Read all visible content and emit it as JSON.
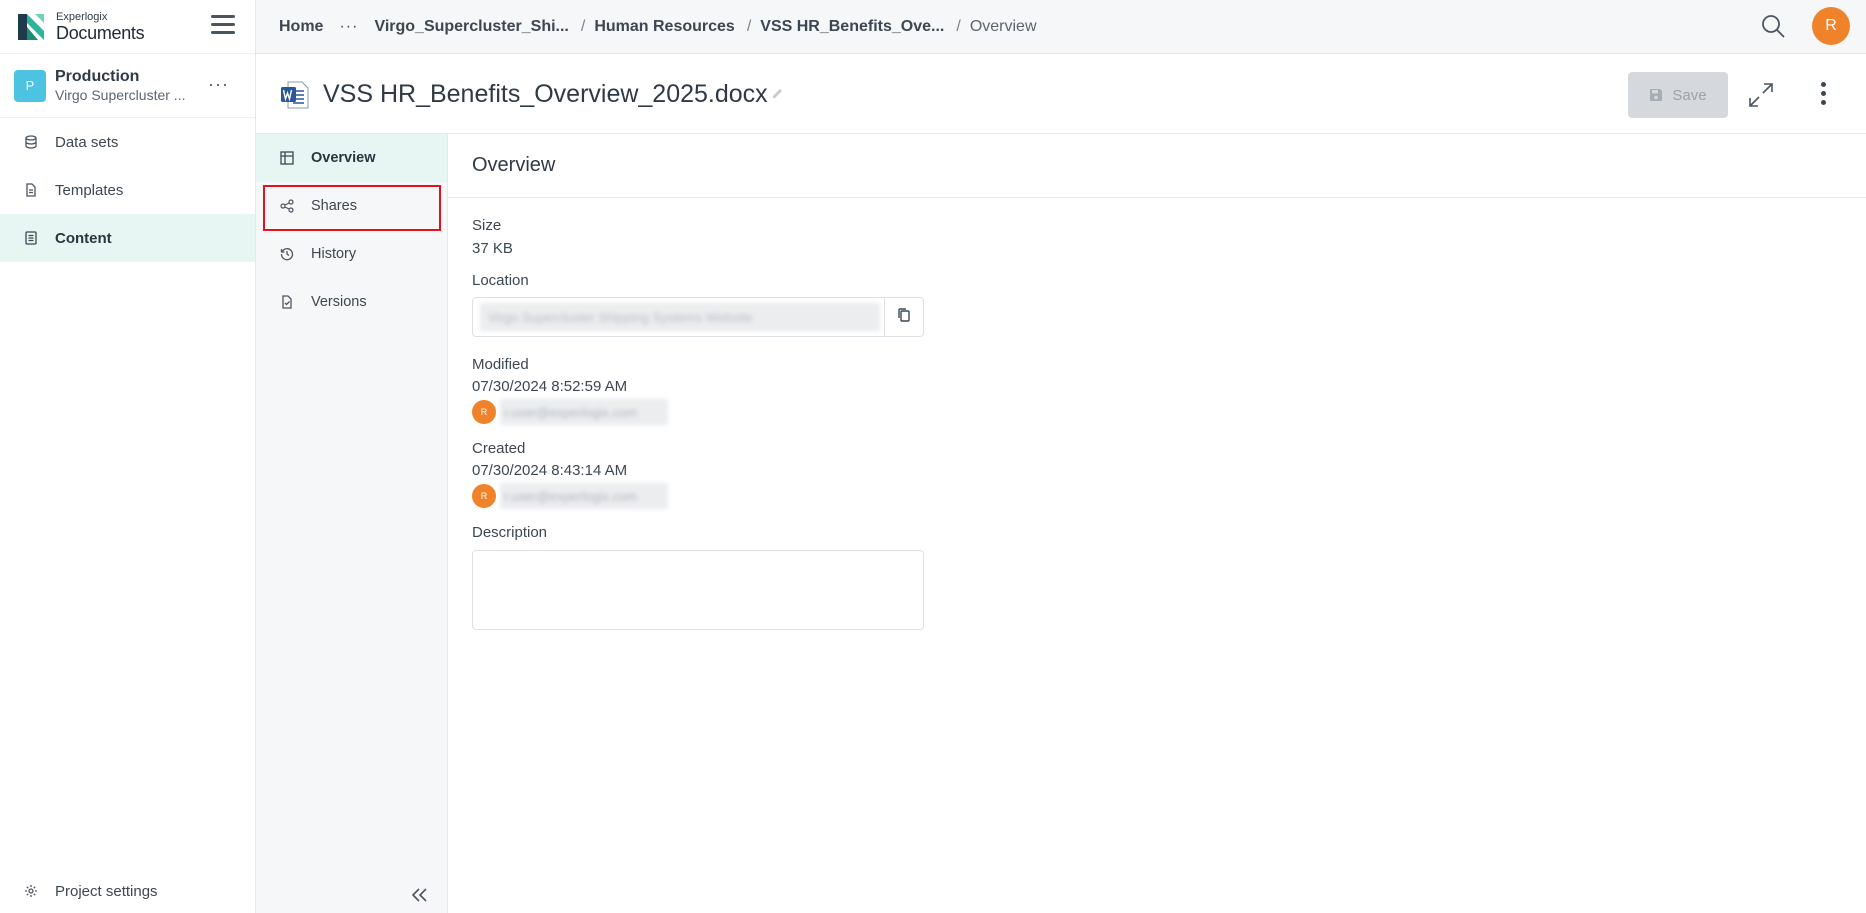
{
  "brand": {
    "small": "Experlogix",
    "big": "Documents"
  },
  "project": {
    "initial": "P",
    "name": "Production",
    "subtitle": "Virgo Supercluster ..."
  },
  "sidebar": {
    "items": [
      {
        "label": "Data sets",
        "icon": "database-icon"
      },
      {
        "label": "Templates",
        "icon": "file-icon"
      },
      {
        "label": "Content",
        "icon": "content-icon",
        "active": true
      }
    ],
    "bottom": {
      "label": "Project settings",
      "icon": "gear-icon"
    }
  },
  "breadcrumb": {
    "home": "Home",
    "overflow": "···",
    "items": [
      "Virgo_Supercluster_Shi...",
      "Human Resources",
      "VSS HR_Benefits_Ove..."
    ],
    "current": "Overview",
    "separator": "/"
  },
  "user": {
    "initial": "R"
  },
  "document": {
    "title": "VSS HR_Benefits_Overview_2025.docx",
    "save_label": "Save"
  },
  "subnav": {
    "items": [
      {
        "label": "Overview",
        "icon": "grid-icon",
        "active": true
      },
      {
        "label": "Shares",
        "icon": "share-icon"
      },
      {
        "label": "History",
        "icon": "history-icon"
      },
      {
        "label": "Versions",
        "icon": "versions-icon"
      }
    ]
  },
  "overview": {
    "title": "Overview",
    "size_label": "Size",
    "size_value": "37 KB",
    "location_label": "Location",
    "location_value": "Virgo Supercluster Shipping Systems Website",
    "modified_label": "Modified",
    "modified_value": "07/30/2024 8:52:59 AM",
    "modified_by": "r.user@experlogix.com",
    "created_label": "Created",
    "created_value": "07/30/2024 8:43:14 AM",
    "created_by": "r.user@experlogix.com",
    "description_label": "Description",
    "description_value": ""
  },
  "colors": {
    "accent": "#e8f6f3",
    "avatar": "#f0832a",
    "project": "#4cc3e0",
    "highlight": "#e0141e"
  }
}
